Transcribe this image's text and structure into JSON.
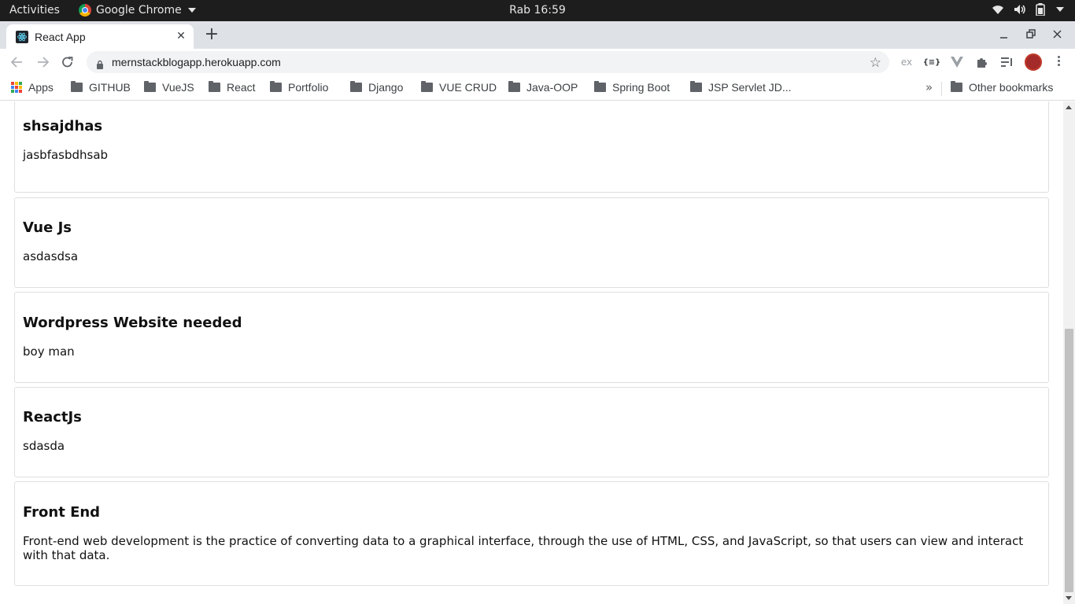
{
  "gnome": {
    "activities": "Activities",
    "app_name": "Google Chrome",
    "clock": "Rab 16:59",
    "tray_icons": [
      "wifi-icon",
      "volume-icon",
      "battery-icon",
      "system-menu-caret-icon"
    ]
  },
  "browser": {
    "tab_title": "React App",
    "tab_favicon": "react-icon",
    "url": "mernstackblogapp.herokuapp.com",
    "extensions": [
      "ex",
      "{≡}",
      "vue-devtools-icon",
      "puzzle-icon",
      "media-queue-icon",
      "profile-avatar"
    ]
  },
  "bookmarks": {
    "apps_label": "Apps",
    "items": [
      "GITHUB",
      "VueJS",
      "React",
      "Portfolio",
      "Django",
      "VUE CRUD",
      "Java-OOP",
      "Spring Boot",
      "JSP Servlet JD..."
    ],
    "overflow": "»",
    "other": "Other bookmarks"
  },
  "posts": [
    {
      "title": "shsajdhas",
      "body": "jasbfasbdhsab"
    },
    {
      "title": "Vue Js",
      "body": "asdasdsa"
    },
    {
      "title": "Wordpress Website needed",
      "body": "boy man"
    },
    {
      "title": "ReactJs",
      "body": "sdasda"
    },
    {
      "title": "Front End",
      "body": "Front-end web development is the practice of converting data to a graphical interface, through the use of HTML, CSS, and JavaScript, so that users can view and interact with that data."
    }
  ],
  "colors": {
    "topbar_bg": "#1d1d1d",
    "tabstrip_bg": "#dee1e6",
    "card_border": "#dfdfdf"
  }
}
